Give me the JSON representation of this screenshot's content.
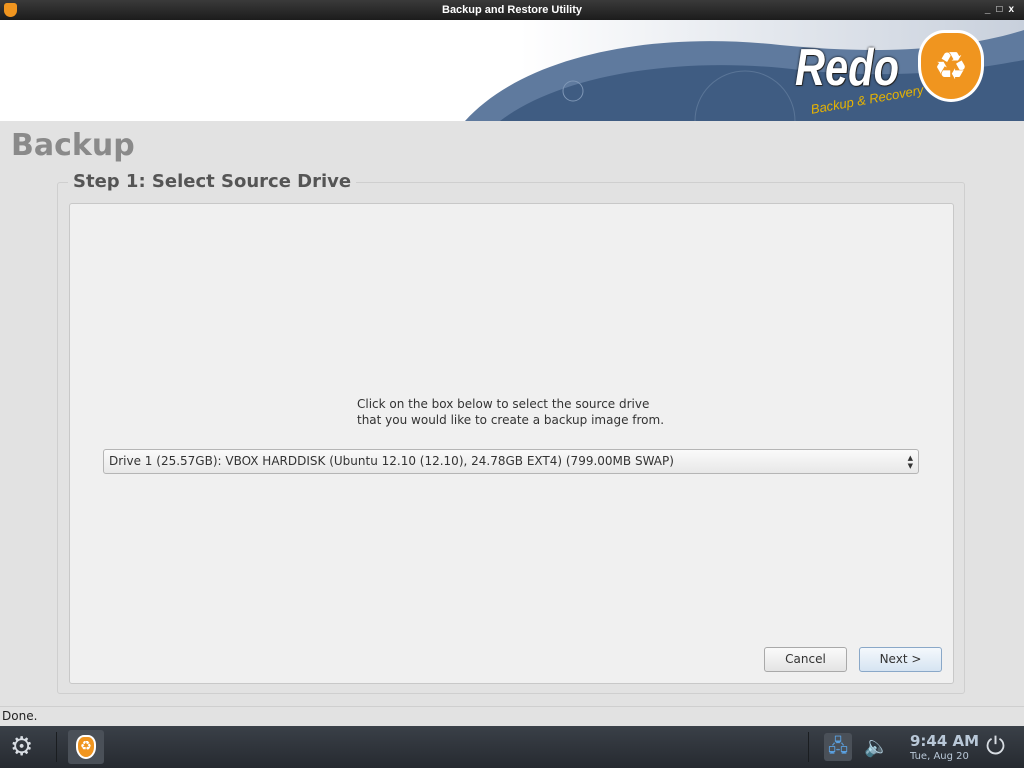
{
  "window": {
    "title": "Backup and Restore Utility",
    "controls": [
      "_",
      "□",
      "x"
    ]
  },
  "banner": {
    "logo": "Redo",
    "logo_tagline": "Backup & Recovery"
  },
  "page": {
    "title": "Backup",
    "step_title": "Step 1: Select Source Drive",
    "instructions_line1": "Click on the box below to select the source drive",
    "instructions_line2": "that you would like to create a backup image from.",
    "drive_select": {
      "value": "Drive 1 (25.57GB): VBOX HARDDISK (Ubuntu 12.10 (12.10), 24.78GB EXT4) (799.00MB SWAP)"
    },
    "cancel_label": "Cancel",
    "next_label": "Next >"
  },
  "status": "Done.",
  "taskbar": {
    "time": "9:44 AM",
    "date": "Tue, Aug 20",
    "icons": [
      "settings-icon",
      "redo-app-icon",
      "network-icon",
      "volume-muted-icon",
      "power-icon"
    ]
  }
}
